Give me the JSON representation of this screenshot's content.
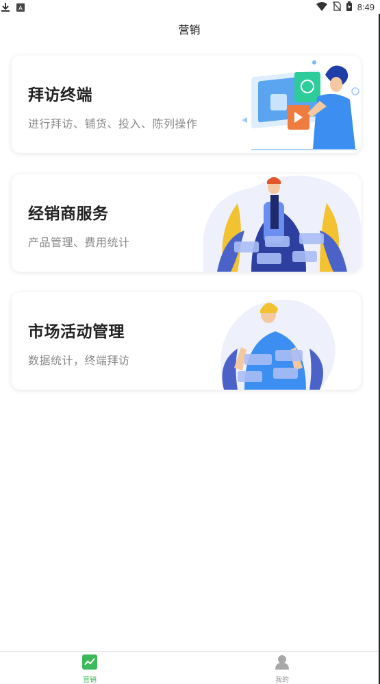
{
  "status_bar": {
    "time": "8:49"
  },
  "header": {
    "title": "营销"
  },
  "cards": [
    {
      "title": "拜访终端",
      "subtitle": "进行拜访、铺货、投入、陈列操作"
    },
    {
      "title": "经销商服务",
      "subtitle": "产品管理、费用统计"
    },
    {
      "title": "市场活动管理",
      "subtitle": "数据统计，终端拜访"
    }
  ],
  "tabs": [
    {
      "label": "营销",
      "active": true
    },
    {
      "label": "我的",
      "active": false
    }
  ],
  "colors": {
    "accent": "#3cba5a",
    "inactive": "#999999",
    "edge": "#222222"
  },
  "icons": [
    "download-icon",
    "app-icon",
    "wifi-icon",
    "no-sim-icon",
    "battery-icon",
    "chart-icon",
    "person-icon"
  ]
}
